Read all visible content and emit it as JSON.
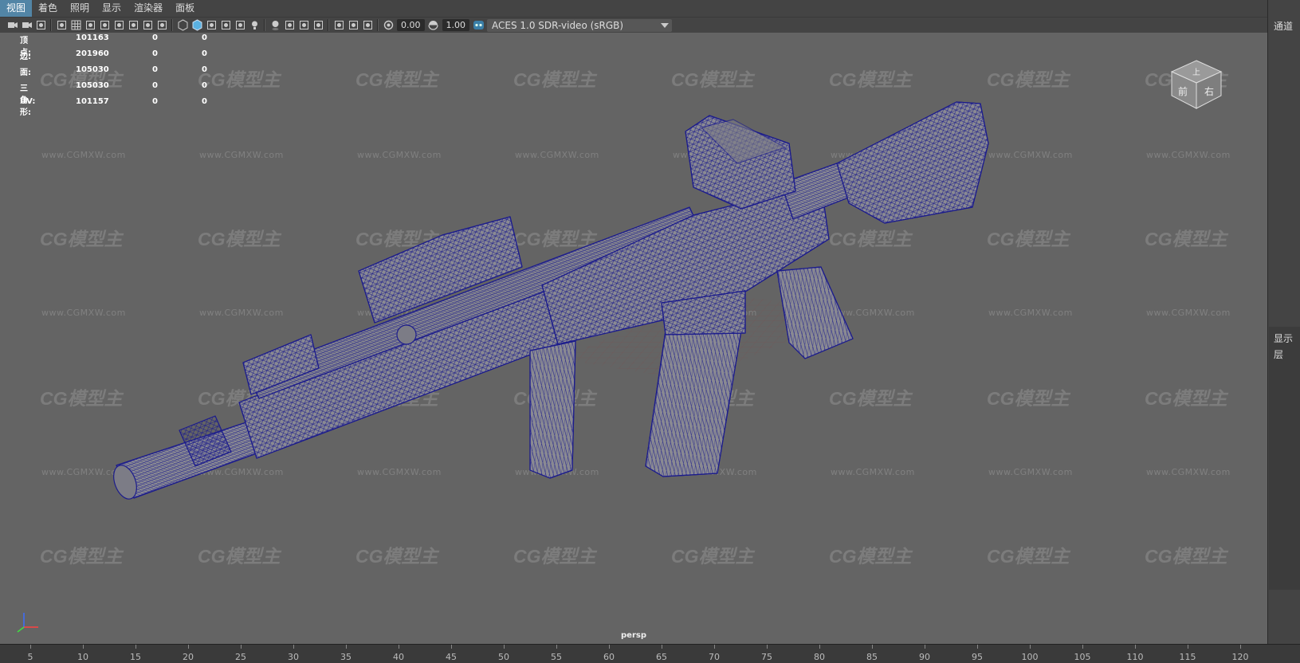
{
  "menu": {
    "items": [
      "视图",
      "着色",
      "照明",
      "显示",
      "渲染器",
      "面板"
    ],
    "active_index": 0
  },
  "toolbar": {
    "exposure_value": "0.00",
    "gamma_value": "1.00",
    "color_management_label": "ACES 1.0 SDR-video (sRGB)",
    "icons": [
      "camera-icon",
      "camera-attr-icon",
      "bookmark-icon",
      "image-plane-icon",
      "grid-icon",
      "film-gate-icon",
      "resolution-gate-icon",
      "gate-mask-icon",
      "field-chart-icon",
      "safe-action-icon",
      "safe-title-icon",
      "wireframe-icon",
      "smooth-shade-icon",
      "default-material-icon",
      "wireframe-on-shaded-icon",
      "xray-icon",
      "lights-icon",
      "shadows-icon",
      "screen-space-ao-icon",
      "motion-blur-icon",
      "aa-icon",
      "isolate-select-icon",
      "xray-joints-icon",
      "xray-active-icon",
      "exposure-icon",
      "gamma-icon",
      "color-management-icon"
    ]
  },
  "heads_up": {
    "rows": [
      {
        "label": "顶点:",
        "v1": "101163",
        "v2": "0",
        "v3": "0"
      },
      {
        "label": "边:",
        "v1": "201960",
        "v2": "0",
        "v3": "0"
      },
      {
        "label": "面:",
        "v1": "105030",
        "v2": "0",
        "v3": "0"
      },
      {
        "label": "三角形:",
        "v1": "105030",
        "v2": "0",
        "v3": "0"
      },
      {
        "label": "UV:",
        "v1": "101157",
        "v2": "0",
        "v3": "0"
      }
    ]
  },
  "viewport": {
    "camera_label": "persp",
    "watermark_logo": "CG模型主",
    "watermark_url": "www.CGMXW.com",
    "wireframe_color": "#1c1c8c",
    "shading_color": "#8a8a92",
    "background_color": "#646464"
  },
  "right_panel": {
    "tab_label": "通道",
    "display_label": "显示",
    "layer_label": "层"
  },
  "timeline": {
    "ticks": [
      "5",
      "10",
      "15",
      "20",
      "25",
      "30",
      "35",
      "40",
      "45",
      "50",
      "55",
      "60",
      "65",
      "70",
      "75",
      "80",
      "85",
      "90",
      "95",
      "100",
      "105",
      "110",
      "115",
      "120"
    ]
  }
}
